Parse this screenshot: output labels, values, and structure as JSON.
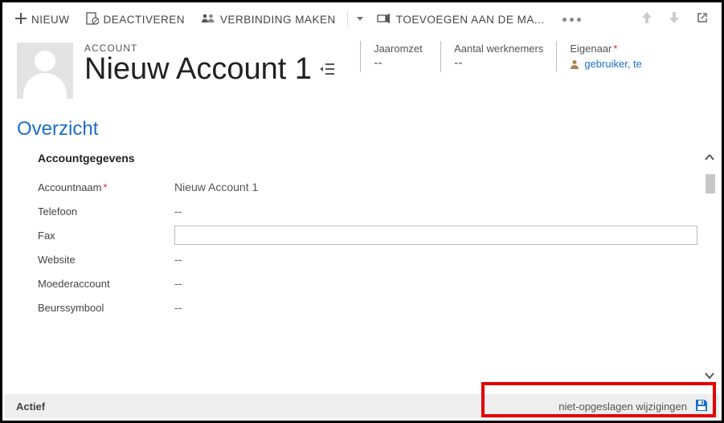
{
  "commands": {
    "new": "NIEUW",
    "deactivate": "DEACTIVEREN",
    "connect": "VERBINDING MAKEN",
    "addto": "TOEVOEGEN AAN DE MA..."
  },
  "header": {
    "entity_label": "ACCOUNT",
    "entity_name": "Nieuw Account 1",
    "fields": {
      "revenue_label": "Jaaromzet",
      "revenue_value": "--",
      "employees_label": "Aantal werknemers",
      "employees_value": "--",
      "owner_label": "Eigenaar",
      "owner_value": "gebruiker, te"
    }
  },
  "section": {
    "title": "Overzicht",
    "subheader": "Accountgegevens"
  },
  "form": {
    "account_name_label": "Accountnaam",
    "account_name_value": "Nieuw Account 1",
    "phone_label": "Telefoon",
    "phone_value": "--",
    "fax_label": "Fax",
    "fax_value": "",
    "website_label": "Website",
    "website_value": "--",
    "parent_label": "Moederaccount",
    "parent_value": "--",
    "ticker_label": "Beurssymbool",
    "ticker_value": "--"
  },
  "status": {
    "state": "Actief",
    "unsaved": "niet-opgeslagen wijzigingen"
  }
}
